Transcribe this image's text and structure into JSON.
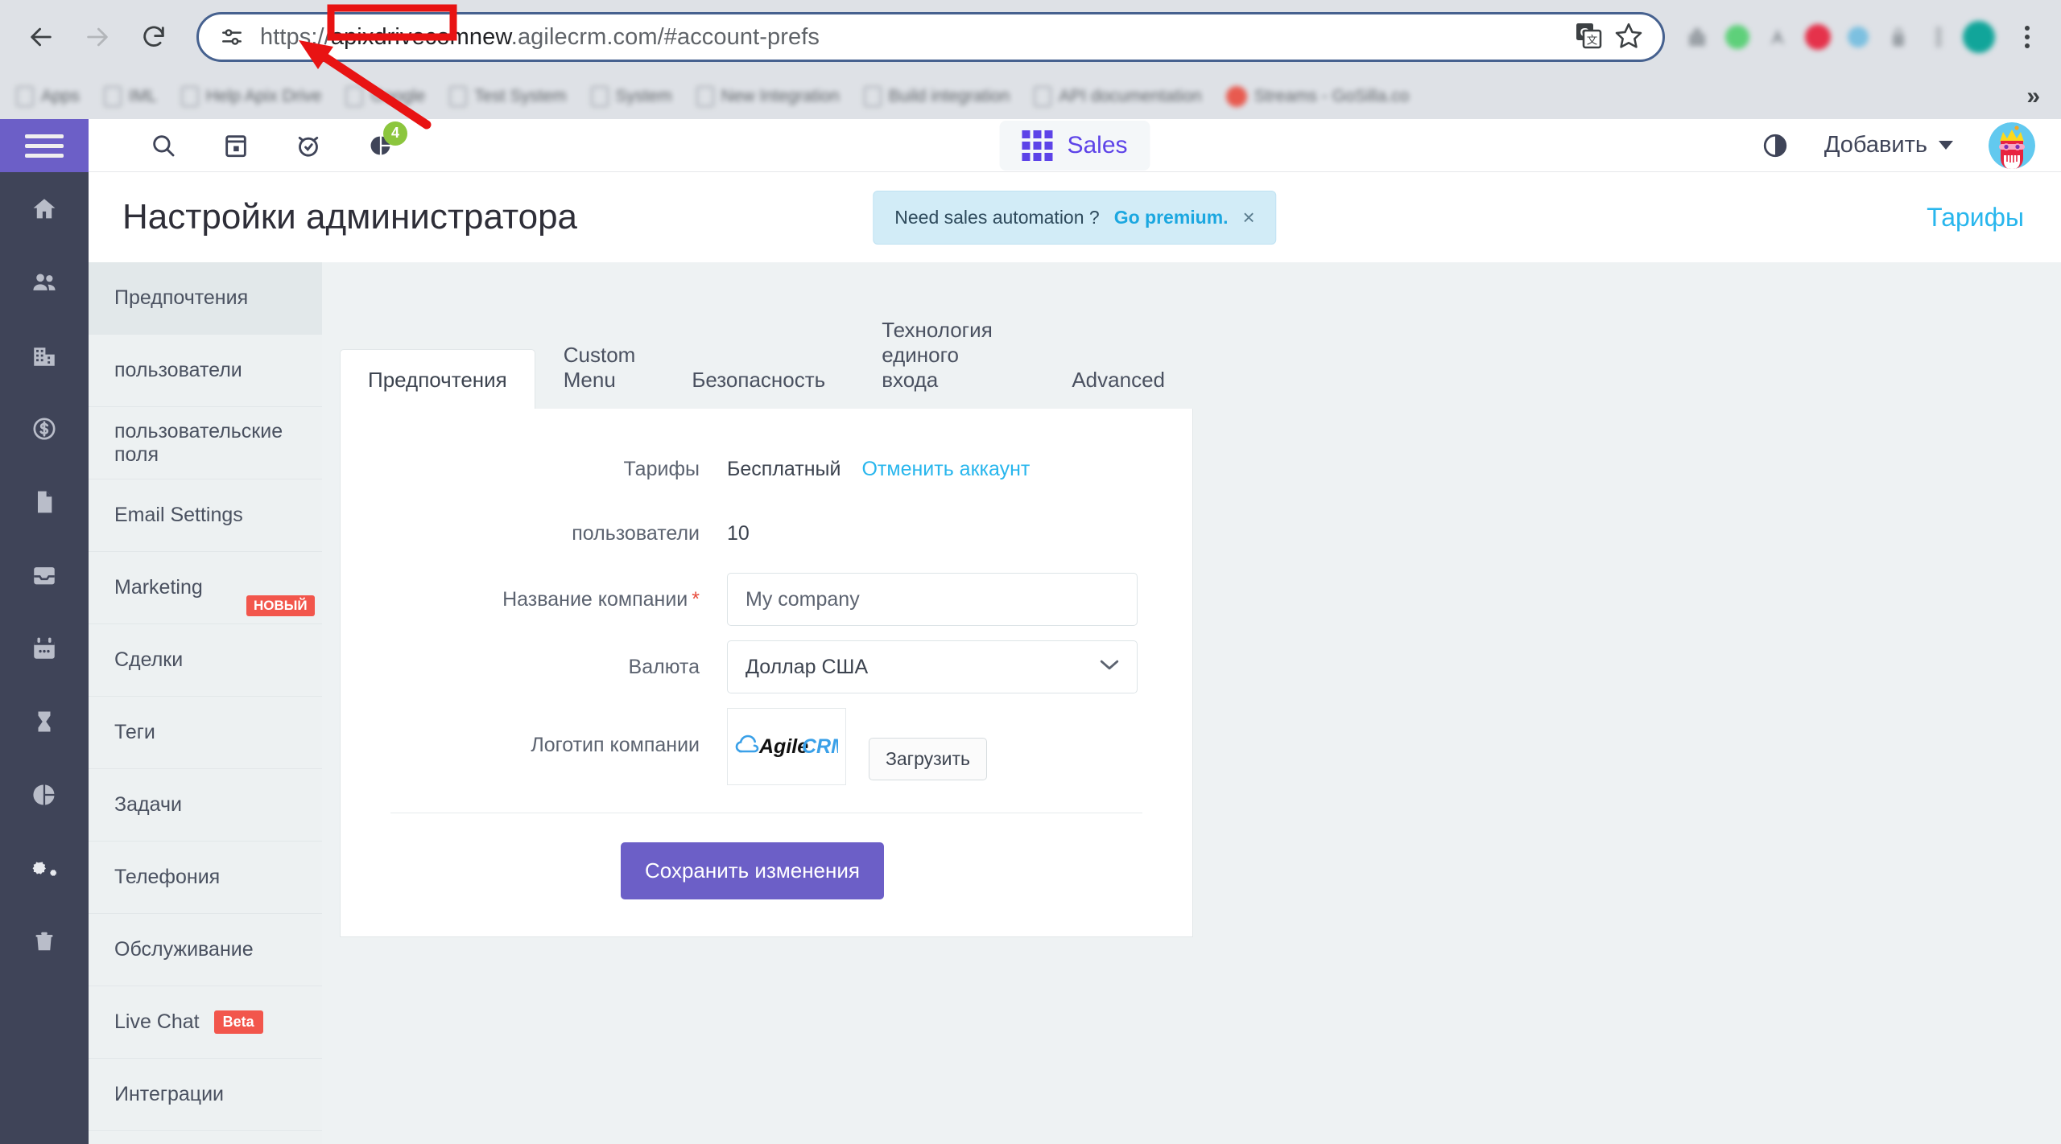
{
  "browser": {
    "back_label": "Back",
    "forward_label": "Forward",
    "reload_label": "Reload",
    "url_prefix": "https://",
    "url_highlight": "apixdrivecomnew",
    "url_suffix": ".agilecrm.com/#account-prefs",
    "url_full": "https://apixdrivecomnew.agilecrm.com/#account-prefs",
    "translate_icon": "google-translate-icon",
    "bookmark_icon": "star-icon",
    "menu_icon": "three-dots-menu-icon",
    "bookmarks": [
      {
        "label": "Apps"
      },
      {
        "label": "IML"
      },
      {
        "label": "Help Apix Drive"
      },
      {
        "label": "Google"
      },
      {
        "label": "Test System"
      },
      {
        "label": "System"
      },
      {
        "label": "New Integration"
      },
      {
        "label": "Build integration"
      },
      {
        "label": "API documentation"
      },
      {
        "label": "Streams - GoSilla.co"
      }
    ],
    "overflow_label": "»"
  },
  "app_header": {
    "hamburger": "menu-icon",
    "icons": [
      {
        "name": "search-icon"
      },
      {
        "name": "calendar-icon"
      },
      {
        "name": "alarm-icon"
      },
      {
        "name": "reports-icon",
        "badge": "4"
      }
    ],
    "module_label": "Sales",
    "theme_toggle": "dark-mode-icon",
    "add_label": "Добавить",
    "avatar": "user-avatar"
  },
  "rail": {
    "items": [
      {
        "name": "home-icon"
      },
      {
        "name": "contacts-icon"
      },
      {
        "name": "companies-icon"
      },
      {
        "name": "deals-icon"
      },
      {
        "name": "documents-icon"
      },
      {
        "name": "inbox-icon"
      },
      {
        "name": "calendar-icon"
      },
      {
        "name": "hourglass-icon"
      },
      {
        "name": "reports-icon"
      },
      {
        "name": "settings-icon"
      },
      {
        "name": "trash-icon"
      }
    ]
  },
  "page": {
    "title": "Настройки администратора",
    "promo_text": "Need sales automation ?",
    "promo_link": "Go premium.",
    "promo_close": "×",
    "plans_link": "Тарифы"
  },
  "settings_nav": {
    "items": [
      {
        "label": "Предпочтения",
        "active": true
      },
      {
        "label": "пользователи"
      },
      {
        "label": "пользовательские поля"
      },
      {
        "label": "Email Settings"
      },
      {
        "label": "Marketing",
        "badge": "новый"
      },
      {
        "label": "Сделки"
      },
      {
        "label": "Теги"
      },
      {
        "label": "Задачи"
      },
      {
        "label": "Телефония"
      },
      {
        "label": "Обслуживание"
      },
      {
        "label": "Live Chat",
        "badge_inline": "Beta"
      },
      {
        "label": "Интеграции"
      }
    ]
  },
  "tabs": [
    {
      "label": "Предпочтения",
      "active": true
    },
    {
      "label": "Custom Menu"
    },
    {
      "label": "Безопасность"
    },
    {
      "label": "Технология единого входа"
    },
    {
      "label": "Advanced"
    }
  ],
  "form": {
    "plan_label": "Тарифы",
    "plan_value": "Бесплатный",
    "plan_cancel_link": "Отменить аккаунт",
    "users_label": "пользователи",
    "users_value": "10",
    "company_label": "Название компании",
    "company_required": "*",
    "company_value": "My company",
    "currency_label": "Валюта",
    "currency_value": "Доллар США",
    "currency_options": [
      "Доллар США"
    ],
    "logo_label": "Логотип компании",
    "logo_alt": "AgileCRM",
    "upload_label": "Загрузить",
    "save_label": "Сохранить изменения"
  },
  "annotation": {
    "highlight_color": "#e81313",
    "arrow_color": "#e81313"
  },
  "colors": {
    "purple": "#6c5fc7",
    "rail": "#3f4458",
    "accent_blue": "#28b6ed",
    "badge_green": "#8cc63e",
    "badge_red": "#f2564c",
    "module_purple": "#5d43e8"
  }
}
